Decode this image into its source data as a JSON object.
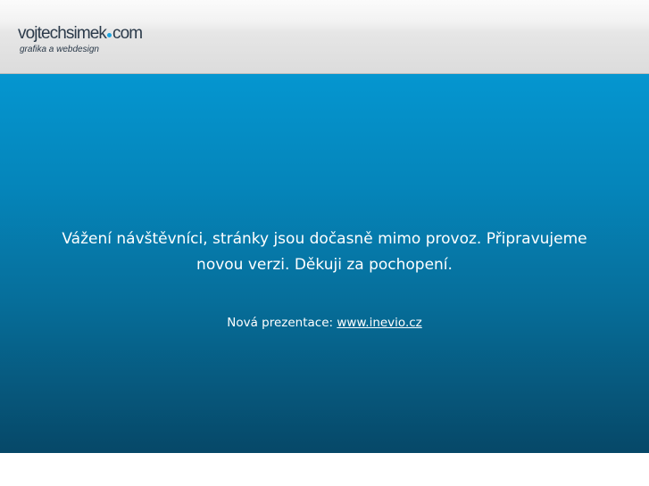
{
  "header": {
    "logo_name": "vojtechsimek",
    "logo_tld": "com",
    "logo_tagline": "grafika a webdesign"
  },
  "main": {
    "message_line1": "Vážení návštěvníci, stránky jsou dočasně mimo provoz. Připravujeme",
    "message_line2": "novou verzi. Děkuji za pochopení.",
    "new_site_label": "Nová prezentace:",
    "new_site_link": "www.inevio.cz"
  },
  "colors": {
    "accent_dot": "#1ea3de",
    "logo_text": "#2b3a4a",
    "panel_top": "#0596d0",
    "panel_bottom": "#064868"
  }
}
